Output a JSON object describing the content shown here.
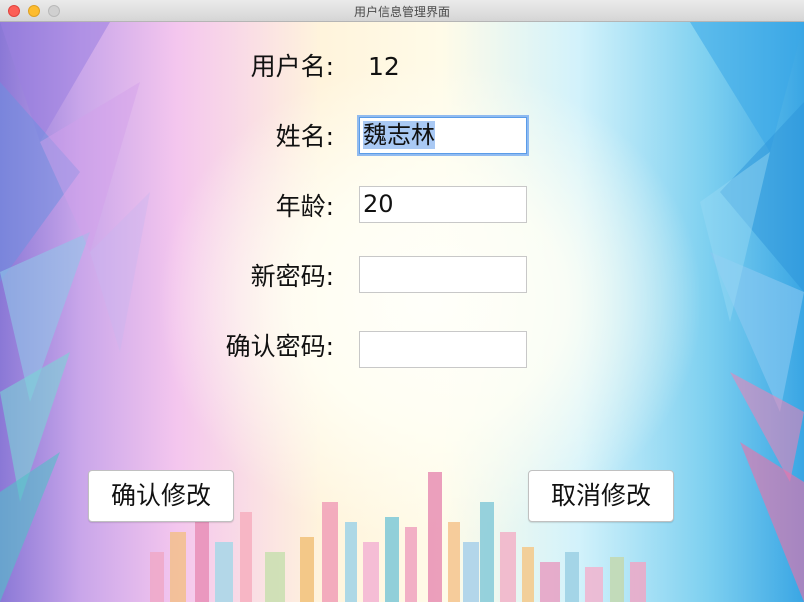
{
  "window": {
    "title": "用户信息管理界面"
  },
  "form": {
    "username_label": "用户名:",
    "username_value": "12",
    "name_label": "姓名:",
    "name_value": "魏志林",
    "age_label": "年龄:",
    "age_value": "20",
    "new_password_label": "新密码:",
    "new_password_value": "",
    "confirm_password_label": "确认密码:",
    "confirm_password_value": ""
  },
  "buttons": {
    "confirm_label": "确认修改",
    "cancel_label": "取消修改"
  },
  "colors": {
    "focus_ring": "#5a9ce8",
    "selection": "#a9c9f4",
    "close_light": "#fc5f57",
    "minimize_light": "#fdbc2e"
  }
}
